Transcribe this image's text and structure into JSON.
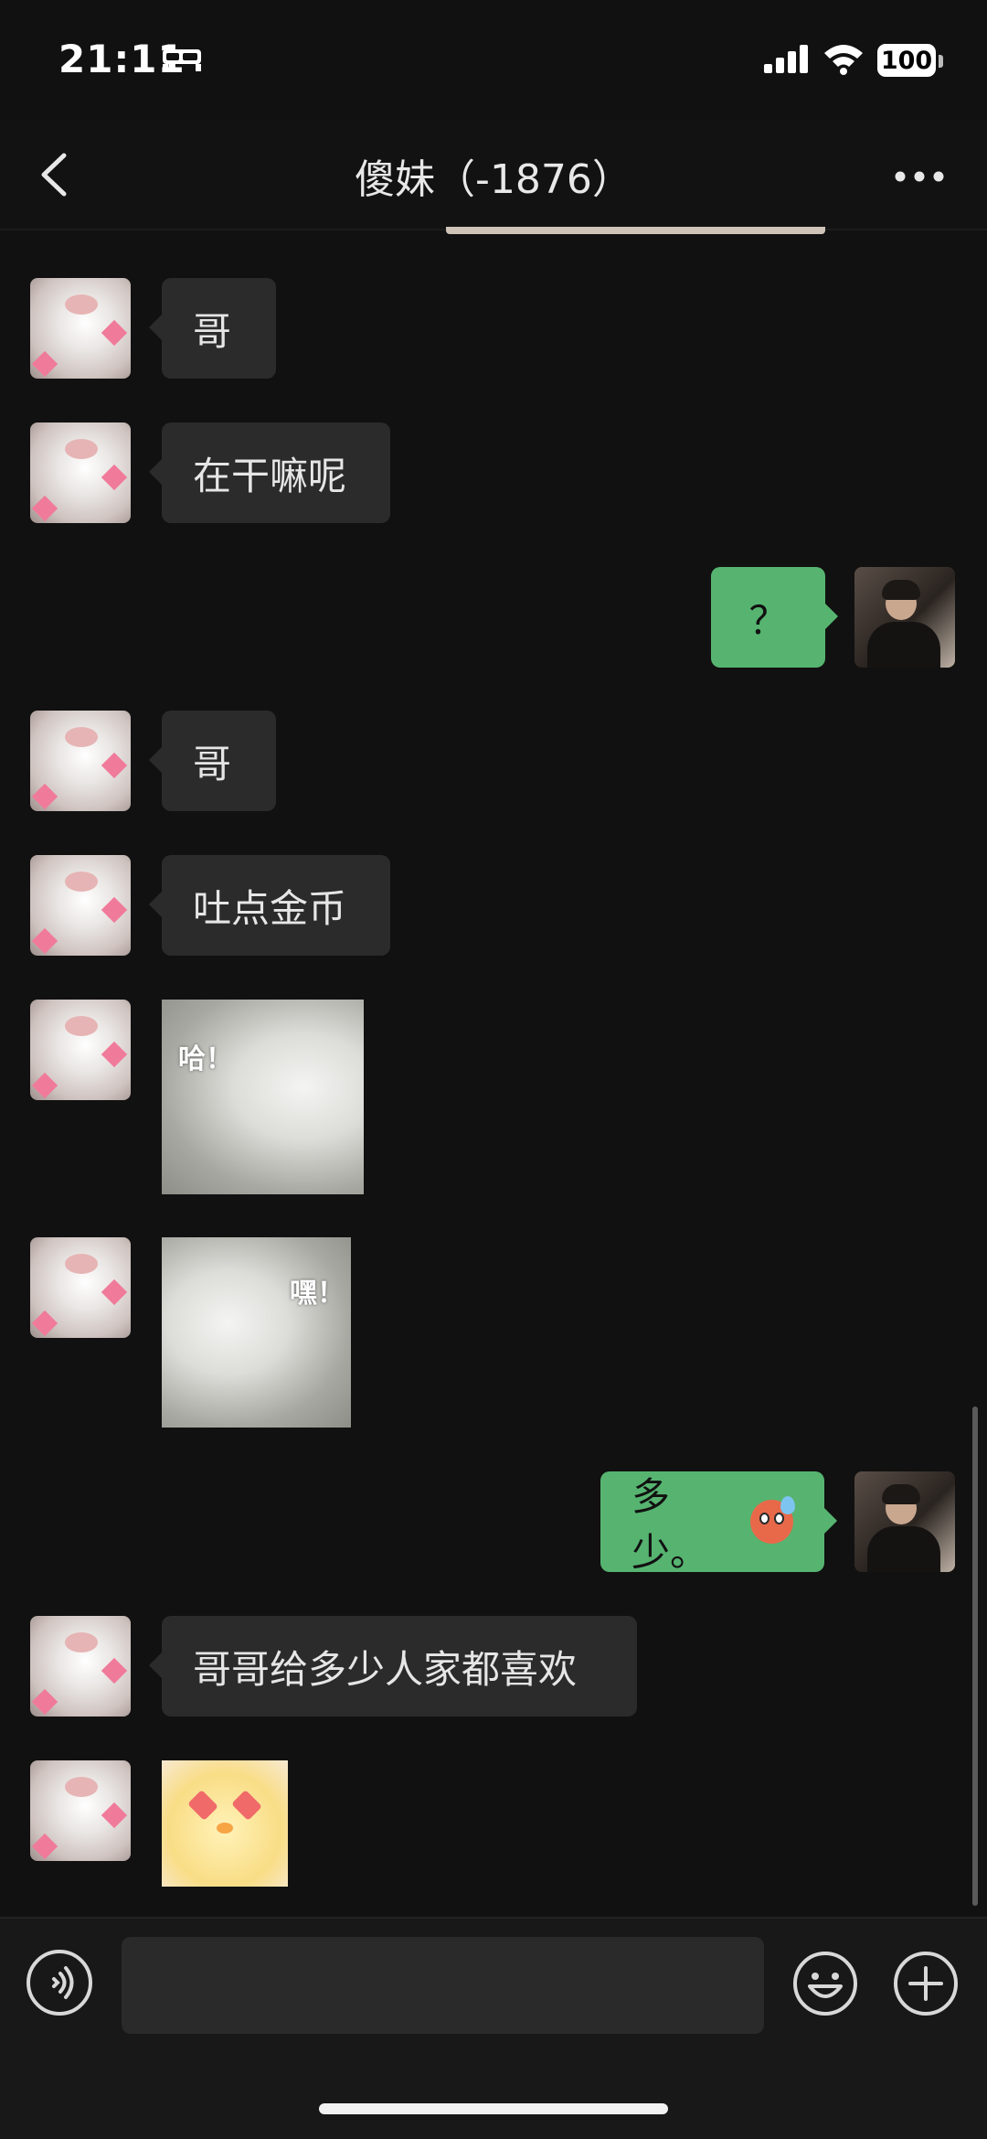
{
  "status": {
    "time": "21:11",
    "battery": "100"
  },
  "header": {
    "title": "傻妹（-1876）"
  },
  "messages": [
    {
      "type": "text",
      "direction": "in",
      "text": "哥"
    },
    {
      "type": "text",
      "direction": "in",
      "text": "在干嘛呢"
    },
    {
      "type": "text",
      "direction": "out",
      "text": "？"
    },
    {
      "type": "text",
      "direction": "in",
      "text": "哥"
    },
    {
      "type": "text",
      "direction": "in",
      "text": "吐点金币"
    },
    {
      "type": "sticker",
      "direction": "in",
      "text": "哈！"
    },
    {
      "type": "sticker",
      "direction": "in",
      "text": "嘿！"
    },
    {
      "type": "text",
      "direction": "out",
      "text": "多少。",
      "emoji": "anxious-sweat-emoji"
    },
    {
      "type": "text",
      "direction": "in",
      "text": "哥哥给多少人家都喜欢"
    },
    {
      "type": "sticker",
      "direction": "in",
      "text": ""
    }
  ],
  "input": {
    "value": "",
    "placeholder": ""
  },
  "colors": {
    "background": "#111111",
    "incoming_bubble": "#2b2b2b",
    "outgoing_bubble": "#56b470"
  }
}
